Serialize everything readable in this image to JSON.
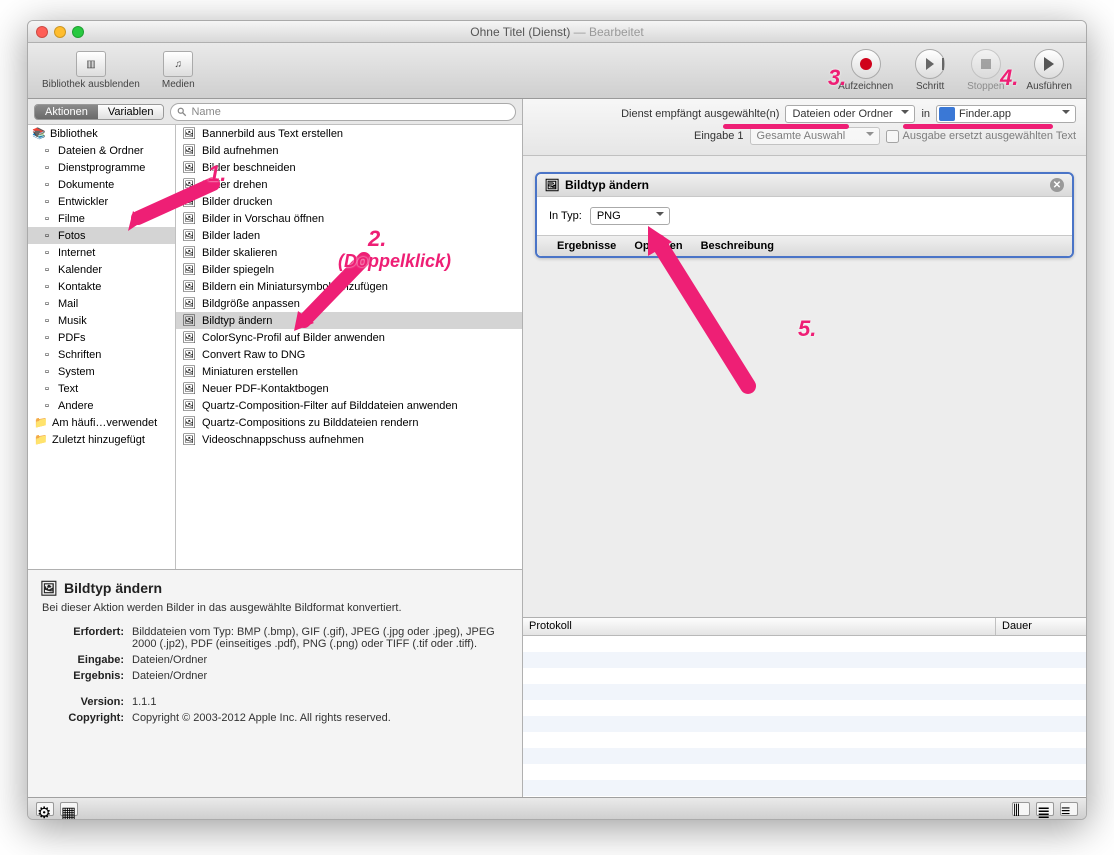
{
  "window": {
    "title_main": "Ohne Titel",
    "title_paren": "(Dienst)",
    "title_suffix": "— Bearbeitet"
  },
  "toolbar": {
    "hide_library": "Bibliothek ausblenden",
    "media": "Medien",
    "record": "Aufzeichnen",
    "step": "Schritt",
    "stop": "Stoppen",
    "run": "Ausführen"
  },
  "library": {
    "tab_actions": "Aktionen",
    "tab_variables": "Variablen",
    "search_placeholder": "Name",
    "root": "Bibliothek",
    "categories": [
      "Dateien & Ordner",
      "Dienstprogramme",
      "Dokumente",
      "Entwickler",
      "Filme",
      "Fotos",
      "Internet",
      "Kalender",
      "Kontakte",
      "Mail",
      "Musik",
      "PDFs",
      "Schriften",
      "System",
      "Text",
      "Andere"
    ],
    "extra": [
      "Am häufi…verwendet",
      "Zuletzt hinzugefügt"
    ],
    "actions": [
      "Bannerbild aus Text erstellen",
      "Bild aufnehmen",
      "Bilder beschneiden",
      "Bilder drehen",
      "Bilder drucken",
      "Bilder in Vorschau öffnen",
      "Bilder laden",
      "Bilder skalieren",
      "Bilder spiegeln",
      "Bildern ein Miniatursymbol hinzufügen",
      "Bildgröße anpassen",
      "Bildtyp ändern",
      "ColorSync-Profil auf Bilder anwenden",
      "Convert Raw to DNG",
      "Miniaturen erstellen",
      "Neuer PDF-Kontaktbogen",
      "Quartz-Composition-Filter auf Bilddateien anwenden",
      "Quartz-Compositions zu Bilddateien rendern",
      "Videoschnappschuss aufnehmen"
    ]
  },
  "info": {
    "title": "Bildtyp ändern",
    "desc": "Bei dieser Aktion werden Bilder in das ausgewählte Bildformat konvertiert.",
    "requires_label": "Erfordert:",
    "requires_val": "Bilddateien vom Typ: BMP (.bmp), GIF (.gif), JPEG (.jpg oder .jpeg), JPEG 2000 (.jp2), PDF (einseitiges .pdf), PNG (.png) oder TIFF (.tif oder .tiff).",
    "input_label": "Eingabe:",
    "input_val": "Dateien/Ordner",
    "result_label": "Ergebnis:",
    "result_val": "Dateien/Ordner",
    "version_label": "Version:",
    "version_val": "1.1.1",
    "copyright_label": "Copyright:",
    "copyright_val": "Copyright © 2003-2012 Apple Inc.  All rights reserved."
  },
  "service": {
    "receives_label": "Dienst empfängt ausgewählte(n)",
    "receives_value": "Dateien oder Ordner",
    "in_label": "in",
    "in_value": "Finder.app",
    "input1_label": "Eingabe 1",
    "input1_value": "Gesamte Auswahl",
    "output_checkbox": "Ausgabe ersetzt ausgewählten Text"
  },
  "action_card": {
    "title": "Bildtyp ändern",
    "field_label": "In Typ:",
    "field_value": "PNG",
    "tab_results": "Ergebnisse",
    "tab_options": "Optionen",
    "tab_desc": "Beschreibung"
  },
  "log": {
    "col_protocol": "Protokoll",
    "col_duration": "Dauer"
  },
  "annotations": {
    "n1": "1.",
    "n2": "2.",
    "n2_sub": "(Doppelklick)",
    "n3": "3.",
    "n4": "4.",
    "n5": "5."
  }
}
